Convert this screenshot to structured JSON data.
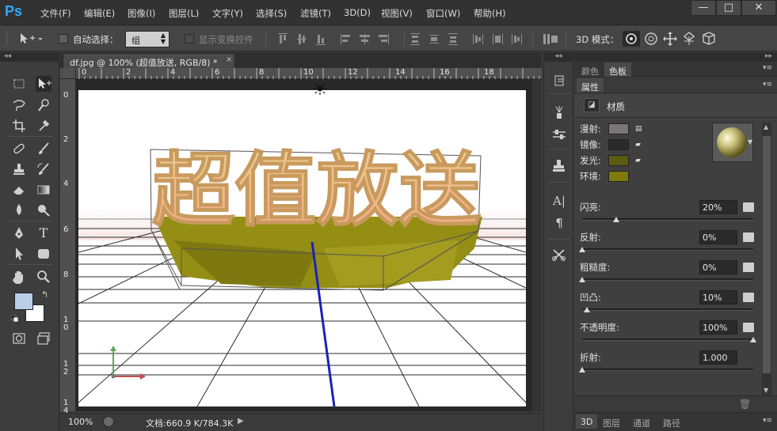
{
  "app": {
    "logo": "Ps",
    "menu": [
      "文件(F)",
      "编辑(E)",
      "图像(I)",
      "图层(L)",
      "文字(Y)",
      "选择(S)",
      "滤镜(T)",
      "3D(D)",
      "视图(V)",
      "窗口(W)",
      "帮助(H)"
    ],
    "window_buttons": [
      "—",
      "□",
      "✕"
    ]
  },
  "options": {
    "auto_select_label": "自动选择：",
    "auto_select_value": "组",
    "show_transform_label": "显示变换控件",
    "mode_3d_label": "3D 模式："
  },
  "document": {
    "tab_title": "df.jpg @ 100% (超值放送, RGB/8) *",
    "close_glyph": "×",
    "canvas_text": "超值放送",
    "ruler_top": [
      "0",
      "2",
      "4",
      "6",
      "8",
      "10",
      "12",
      "14",
      "16",
      "18"
    ],
    "ruler_left": [
      "0",
      "2",
      "4",
      "6",
      "8",
      "1\n0",
      "1\n2",
      "1\n4"
    ],
    "zoom": "100%",
    "doc_size": "文档:660.9 K/784.3K"
  },
  "panel": {
    "tabs_top": [
      "颜色",
      "色板"
    ],
    "tab_active": "属性",
    "section_title": "材质",
    "colors": [
      {
        "label": "漫射:",
        "color": "#7a7678"
      },
      {
        "label": "镜像:",
        "color": "#2b2a2b"
      },
      {
        "label": "发光:",
        "color": "#5c5c10"
      },
      {
        "label": "环境:",
        "color": "#7d7a0e"
      }
    ],
    "sliders": [
      {
        "label": "闪亮:",
        "value": "20%",
        "frac": 0.2
      },
      {
        "label": "反射:",
        "value": "0%",
        "frac": 0.0
      },
      {
        "label": "粗糙度:",
        "value": "0%",
        "frac": 0.0
      },
      {
        "label": "凹凸:",
        "value": "10%",
        "frac": 0.03
      },
      {
        "label": "不透明度:",
        "value": "100%",
        "frac": 1.0
      },
      {
        "label": "折射:",
        "value": "1.000",
        "frac": 0.0
      }
    ],
    "bottom_tabs": [
      "3D",
      "图层",
      "通道",
      "路径"
    ]
  },
  "colors": {
    "text_gradient_top": "#e8c98a",
    "text_gradient_bottom": "#f1a888",
    "extrusion": "#8f8a12",
    "axis_y": "#5aa85a",
    "axis_x": "#c05050",
    "axis_z": "#1a22b8"
  }
}
